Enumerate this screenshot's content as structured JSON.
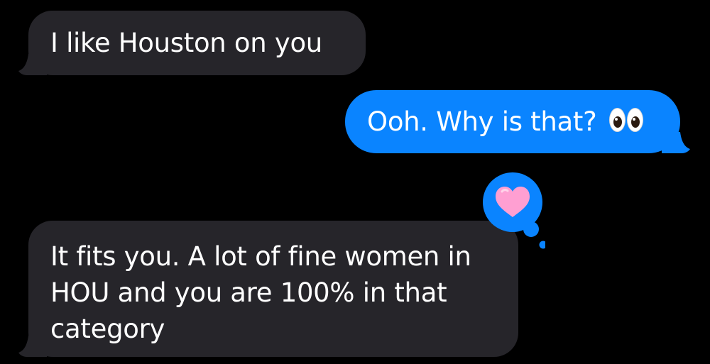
{
  "conversation": {
    "messages": [
      {
        "direction": "incoming",
        "text": "I like Houston on you"
      },
      {
        "direction": "outgoing",
        "text": "Ooh. Why is that?",
        "emoji": "eyes-emoji"
      },
      {
        "direction": "incoming",
        "lines": [
          "It fits you. A lot of fine women in",
          "HOU and you are 100% in that",
          "category"
        ],
        "reaction": "heart-icon"
      }
    ]
  },
  "colors": {
    "background": "#000000",
    "incoming_bubble": "#26252a",
    "outgoing_bubble": "#0a84ff",
    "text": "#ffffff",
    "heart": "#ff9fd2"
  }
}
